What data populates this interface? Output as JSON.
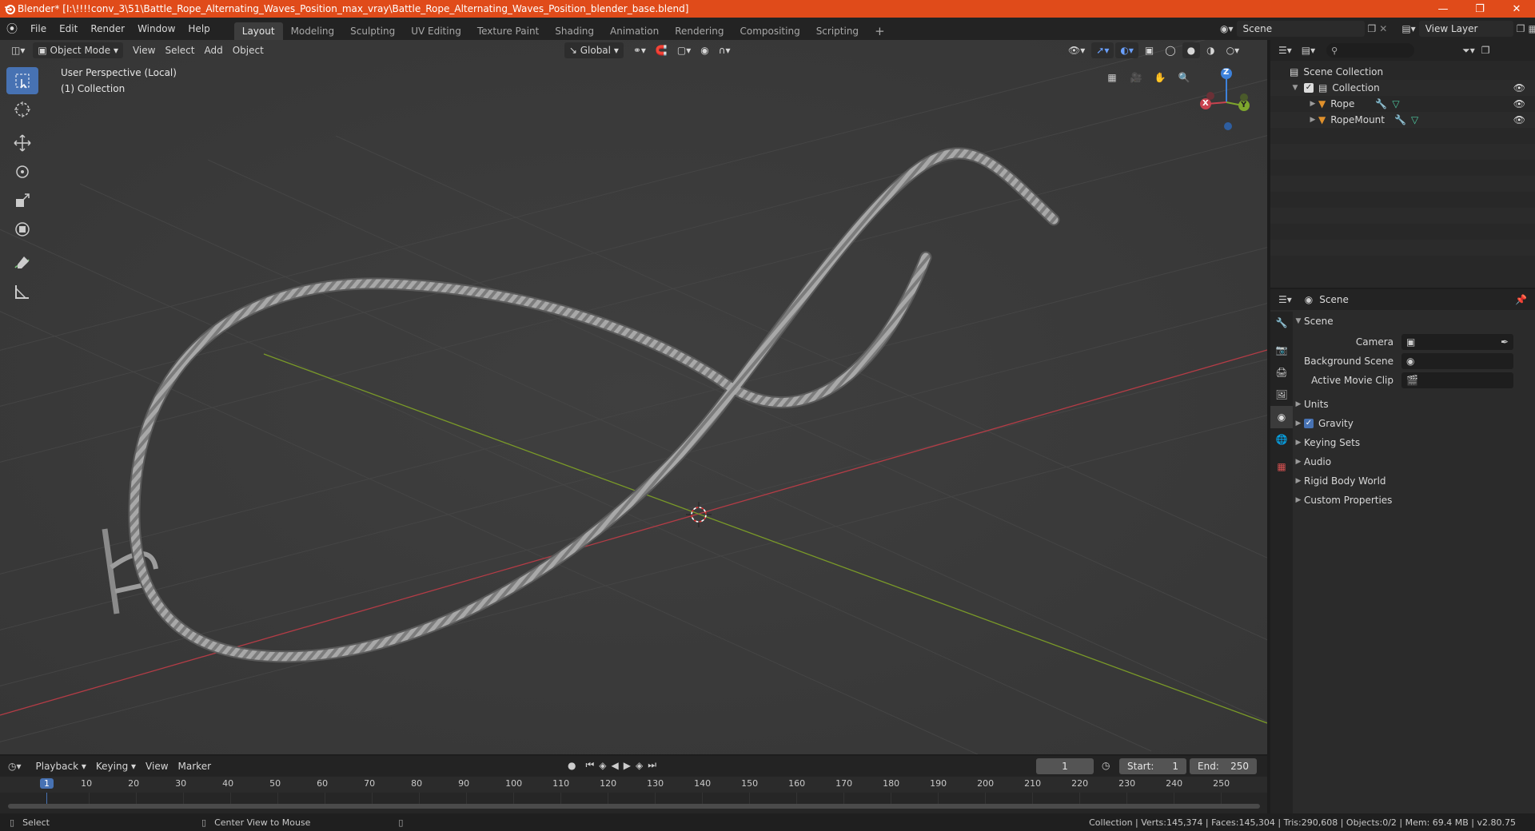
{
  "window": {
    "title": "Blender* [I:\\!!!!conv_3\\51\\Battle_Rope_Alternating_Waves_Position_max_vray\\Battle_Rope_Alternating_Waves_Position_blender_base.blend]"
  },
  "menu": [
    "File",
    "Edit",
    "Render",
    "Window",
    "Help"
  ],
  "workspaces": {
    "tabs": [
      "Layout",
      "Modeling",
      "Sculpting",
      "UV Editing",
      "Texture Paint",
      "Shading",
      "Animation",
      "Rendering",
      "Compositing",
      "Scripting"
    ],
    "active": "Layout",
    "add": "+"
  },
  "scene_selector": {
    "value": "Scene"
  },
  "view_layer_selector": {
    "value": "View Layer"
  },
  "viewport_header": {
    "mode": "Object Mode",
    "menus": [
      "View",
      "Select",
      "Add",
      "Object"
    ],
    "orientation": "Global"
  },
  "viewport": {
    "perspective": "User Perspective (Local)",
    "collection": "(1) Collection",
    "gizmo_axes": {
      "x": "X",
      "y": "Y",
      "z": "Z"
    }
  },
  "outliner": {
    "search_placeholder": "",
    "root": "Scene Collection",
    "collection": "Collection",
    "objects": [
      "Rope",
      "RopeMount"
    ]
  },
  "properties": {
    "context": "Scene",
    "panel_title": "Scene",
    "camera_label": "Camera",
    "background_scene_label": "Background Scene",
    "active_movie_clip_label": "Active Movie Clip",
    "panels": [
      "Units",
      "Gravity",
      "Keying Sets",
      "Audio",
      "Rigid Body World",
      "Custom Properties"
    ],
    "gravity_enabled": true
  },
  "timeline": {
    "menus": [
      "Playback",
      "Keying",
      "View",
      "Marker"
    ],
    "current_frame": "1",
    "start_label": "Start:",
    "start": "1",
    "end_label": "End:",
    "end": "250",
    "ruler": [
      "1",
      "10",
      "20",
      "30",
      "40",
      "50",
      "60",
      "70",
      "80",
      "90",
      "100",
      "110",
      "120",
      "130",
      "140",
      "150",
      "160",
      "170",
      "180",
      "190",
      "200",
      "210",
      "220",
      "230",
      "240",
      "250"
    ]
  },
  "statusbar": {
    "left_action": "Select",
    "middle_action": "Center View to Mouse",
    "stats": "Collection | Verts:145,374 | Faces:145,304 | Tris:290,608 | Objects:0/2 | Mem: 69.4 MB | v2.80.75"
  },
  "colors": {
    "title_bar": "#e04b1a",
    "active_tool": "#4772b3",
    "x_axis": "#c8434f",
    "y_axis": "#7ea62d",
    "z_axis": "#3d82dc",
    "object_icon": "#e0912c"
  }
}
